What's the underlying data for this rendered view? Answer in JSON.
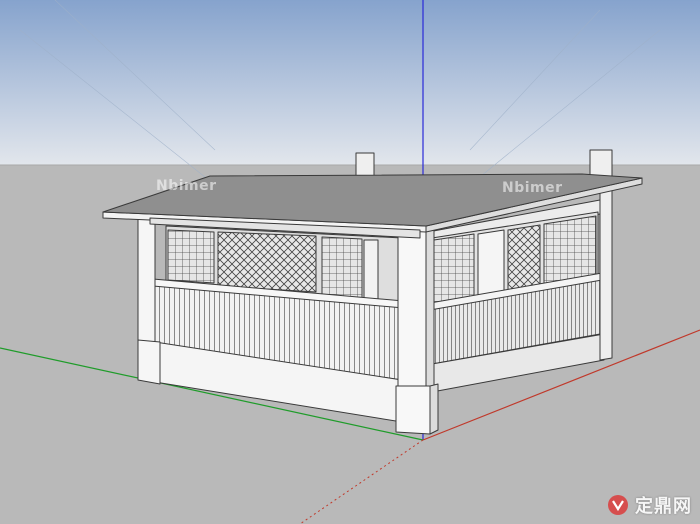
{
  "watermarks": {
    "left": "Nbimer",
    "right": "Nbimer"
  },
  "brand": {
    "text": "定鼎网",
    "icon": "brand-mark-icon"
  },
  "colors": {
    "sky_top": "#8aa6cf",
    "sky_bottom": "#dfe4ea",
    "ground": "#b9b9b9",
    "axis_blue": "#2a2ad8",
    "axis_red": "#c0392b",
    "axis_green": "#1f9c2a",
    "roof_top": "#8f8f8f",
    "wall_light": "#f3f3f3",
    "wall_shade": "#e3e3e3",
    "line": "#3a3a3a"
  }
}
